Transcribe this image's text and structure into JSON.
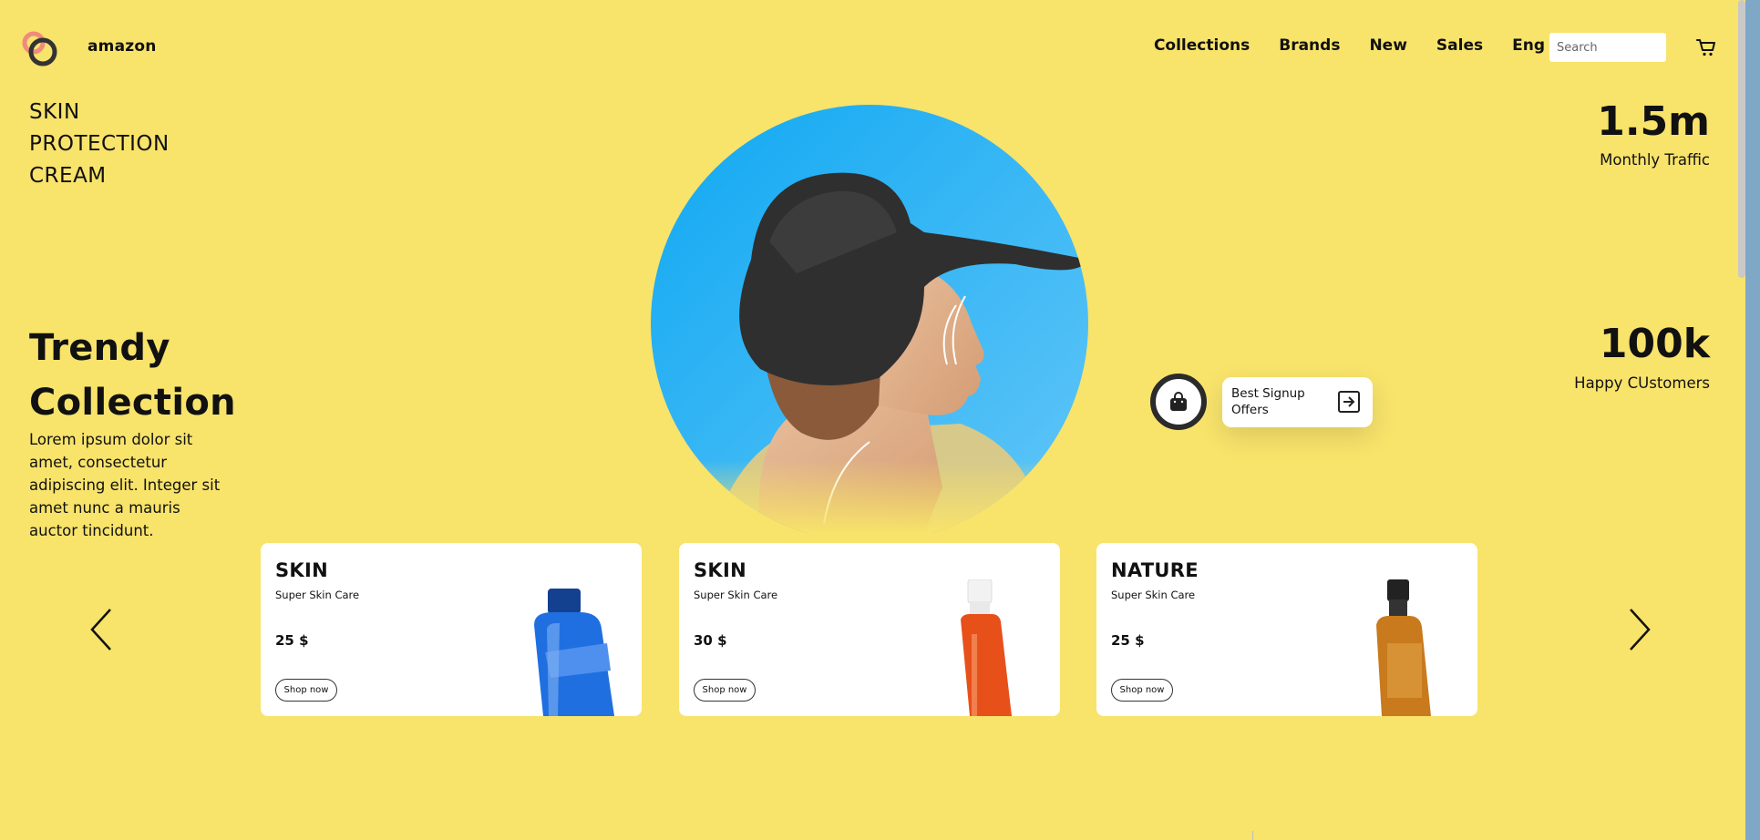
{
  "header": {
    "brand": "amazon",
    "nav": [
      "Collections",
      "Brands",
      "New",
      "Sales",
      "Eng"
    ],
    "search_placeholder": "Search"
  },
  "hero": {
    "skin_title": [
      "SKIN",
      "PROTECTION",
      "CREAM"
    ],
    "collection_title": [
      "Trendy",
      "Collection"
    ],
    "description": "Lorem ipsum dolor sit amet, consectetur adipiscing elit. Integer sit amet nunc a mauris auctor tincidunt.",
    "stats": [
      {
        "value": "1.5m",
        "label": "Monthly Traffic"
      },
      {
        "value": "100k",
        "label": "Happy CUstomers"
      }
    ],
    "signup_offer": "Best Signup Offers"
  },
  "products": [
    {
      "title": "SKIN",
      "subtitle": "Super Skin Care",
      "price": "25 $",
      "button": "Shop now",
      "bottle_color": "#1f6fe0"
    },
    {
      "title": "SKIN",
      "subtitle": "Super Skin Care",
      "price": "30 $",
      "button": "Shop now",
      "bottle_color": "#e8501a"
    },
    {
      "title": "NATURE",
      "subtitle": "Super Skin Care",
      "price": "25 $",
      "button": "Shop now",
      "bottle_color": "#c87a1c"
    }
  ],
  "colors": {
    "background": "#f8e36b",
    "hero_circle": "#26b0f5",
    "logo_accent": "#f08a7e",
    "dark": "#2b2b2b"
  },
  "icons": [
    "logo-rings-icon",
    "cart-icon",
    "shopping-bag-icon",
    "arrow-right-box-icon",
    "chevron-left-icon",
    "chevron-right-icon"
  ]
}
